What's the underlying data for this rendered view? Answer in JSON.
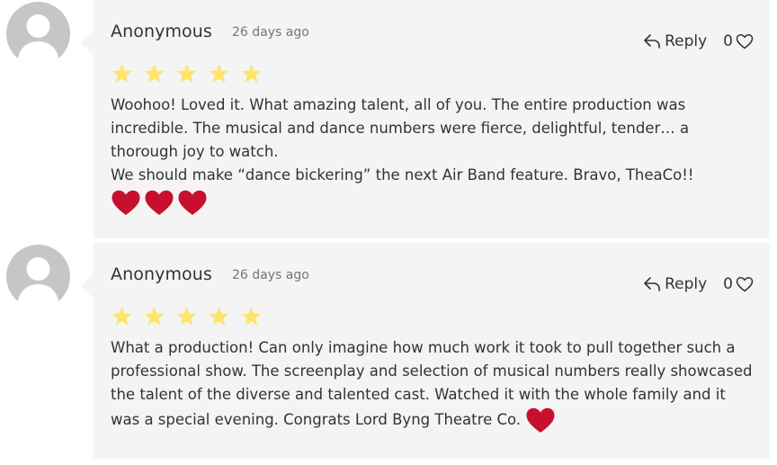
{
  "comments": [
    {
      "author": "Anonymous",
      "time": "26 days ago",
      "reply_label": "Reply",
      "like_count": "0",
      "rating": 5,
      "text_lines": [
        "Woohoo! Loved it. What amazing talent, all of you. The entire production was incredible. The musical and dance numbers were fierce, delightful, tender… a thorough joy to watch.",
        "We should make “dance bickering” the next Air Band feature. Bravo, TheaCo!!"
      ],
      "hearts": 3
    },
    {
      "author": "Anonymous",
      "time": "26 days ago",
      "reply_label": "Reply",
      "like_count": "0",
      "rating": 5,
      "text_lines": [
        "What a production! Can only imagine how much work it took to pull together such a professional show. The screenplay and selection of musical numbers really showcased the talent of the diverse and talented cast. Watched it with the whole family and it was a special evening. Congrats Lord Byng Theatre Co."
      ],
      "hearts": 1
    }
  ],
  "colors": {
    "star": "#fde46d",
    "heart": "#c8102e",
    "bubble": "#f4f4f4",
    "avatar": "#c6c6c6"
  }
}
